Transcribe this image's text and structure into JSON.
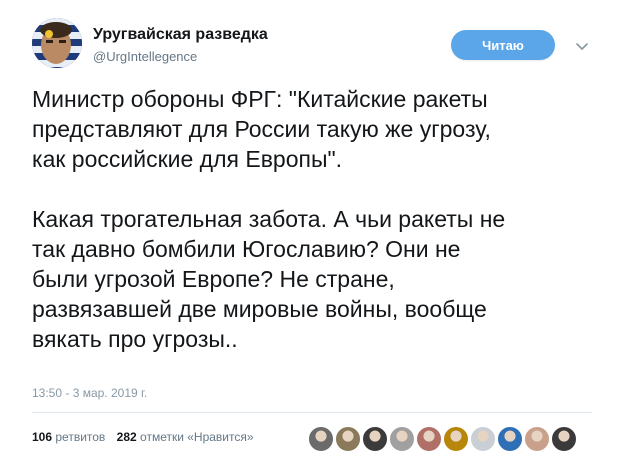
{
  "author": {
    "name": "Уругвайская разведка",
    "handle": "@UrgIntellegence",
    "avatar_icon": "uruguay-flag-face-avatar"
  },
  "follow_button": {
    "label": "Читаю",
    "color": "#5aa6e9"
  },
  "more_menu_icon": "chevron-down-icon",
  "tweet": {
    "paragraph_1_line_1": "Министр обороны ФРГ: \"Китайские ракеты",
    "paragraph_1_line_2": "представляют для России такую же угрозу,",
    "paragraph_1_line_3": "как российские для Европы\".",
    "paragraph_2_line_1": "Какая трогательная забота. А чьи ракеты не",
    "paragraph_2_line_2": "так давно бомбили Югославию? Они не",
    "paragraph_2_line_3": "были угрозой Европе? Не стране,",
    "paragraph_2_line_4": "развязавшей две мировые войны, вообще",
    "paragraph_2_line_5": "вякать про угрозы.."
  },
  "timestamp": "13:50 - 3 мар. 2019 г.",
  "stats": {
    "retweets_count": "106",
    "retweets_label": "ретвитов",
    "likes_count": "282",
    "likes_label": "отметки «Нравится»"
  },
  "likers": [
    {
      "icon": "liker-avatar-1",
      "color": "#6b6b6b"
    },
    {
      "icon": "liker-avatar-2",
      "color": "#8a7a5a"
    },
    {
      "icon": "liker-avatar-3",
      "color": "#3b3b3b"
    },
    {
      "icon": "liker-avatar-4",
      "color": "#a0a0a0"
    },
    {
      "icon": "liker-avatar-5",
      "color": "#b07068"
    },
    {
      "icon": "liker-avatar-6",
      "color": "#b8860b"
    },
    {
      "icon": "liker-avatar-7",
      "color": "#c9cfd4"
    },
    {
      "icon": "liker-avatar-8",
      "color": "#2f6fb5"
    },
    {
      "icon": "liker-avatar-9",
      "color": "#c9a08a"
    },
    {
      "icon": "liker-avatar-10",
      "color": "#3a3a3a"
    }
  ],
  "colors": {
    "text": "#14171a",
    "secondary": "#657786",
    "timestamp": "#8899a6",
    "divider": "#e1e8ed"
  }
}
